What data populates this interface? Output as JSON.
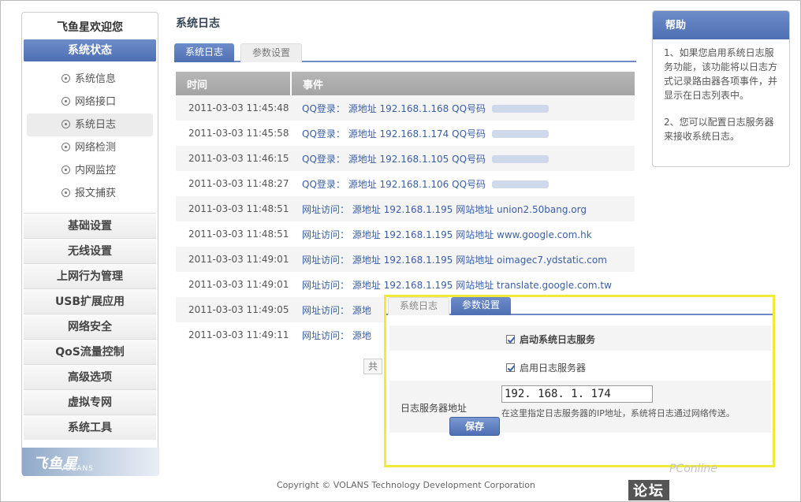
{
  "sidebar": {
    "brand": "飞鱼星欢迎您",
    "status_title": "系统状态",
    "sub_items": [
      "系统信息",
      "网络接口",
      "系统日志",
      "网络检测",
      "内网监控",
      "报文捕获"
    ],
    "menu_items": [
      "基础设置",
      "无线设置",
      "上网行为管理",
      "USB扩展应用",
      "网络安全",
      "QoS流量控制",
      "高级选项",
      "虚拟专网",
      "系统工具"
    ],
    "logo_text": "飞鱼星",
    "logo_sub": "VOLANS"
  },
  "main": {
    "page_title": "系统日志",
    "tabs": [
      "系统日志",
      "参数设置"
    ],
    "table": {
      "headers": [
        "时间",
        "事件"
      ],
      "rows": [
        {
          "time": "2011-03-03 11:45:48",
          "event": "QQ登录：  源地址  192.168.1.168 QQ号码"
        },
        {
          "time": "2011-03-03 11:45:58",
          "event": "QQ登录：  源地址  192.168.1.174 QQ号码"
        },
        {
          "time": "2011-03-03 11:46:15",
          "event": "QQ登录：  源地址  192.168.1.105 QQ号码"
        },
        {
          "time": "2011-03-03 11:48:27",
          "event": "QQ登录：  源地址  192.168.1.106 QQ号码"
        },
        {
          "time": "2011-03-03 11:48:51",
          "event": "网址访问：  源地址  192.168.1.195 网站地址  union2.50bang.org"
        },
        {
          "time": "2011-03-03 11:48:51",
          "event": "网址访问：  源地址  192.168.1.195 网站地址  www.google.com.hk"
        },
        {
          "time": "2011-03-03 11:49:01",
          "event": "网址访问：  源地址  192.168.1.195 网站地址  oimagec7.ydstatic.com"
        },
        {
          "time": "2011-03-03 11:49:01",
          "event": "网址访问：  源地址  192.168.1.195 网站地址  translate.google.com.tw"
        },
        {
          "time": "2011-03-03 11:49:05",
          "event": "网址访问：  源地"
        },
        {
          "time": "2011-03-03 11:49:11",
          "event": "网址访问：  源地"
        }
      ]
    },
    "pager": "共"
  },
  "help": {
    "title": "帮助",
    "p1": "1、如果您启用系统日志服务功能，该功能将以日志方式记录路由器各项事件，并显示在日志列表中。",
    "p2": "2、您可以配置日志服务器来接收系统日志。"
  },
  "overlay": {
    "tabs": [
      "系统日志",
      "参数设置"
    ],
    "enable_service": "启动系统日志服务",
    "enable_server": "启用日志服务器",
    "server_label": "日志服务器地址",
    "server_value": "192. 168. 1. 174",
    "hint": "在这里指定日志服务器的IP地址，系统将日志通过网络传送。",
    "save": "保存"
  },
  "footer": "Copyright © VOLANS Technology Development Corporation",
  "watermark": {
    "site": "PConline",
    "text": "论坛"
  }
}
